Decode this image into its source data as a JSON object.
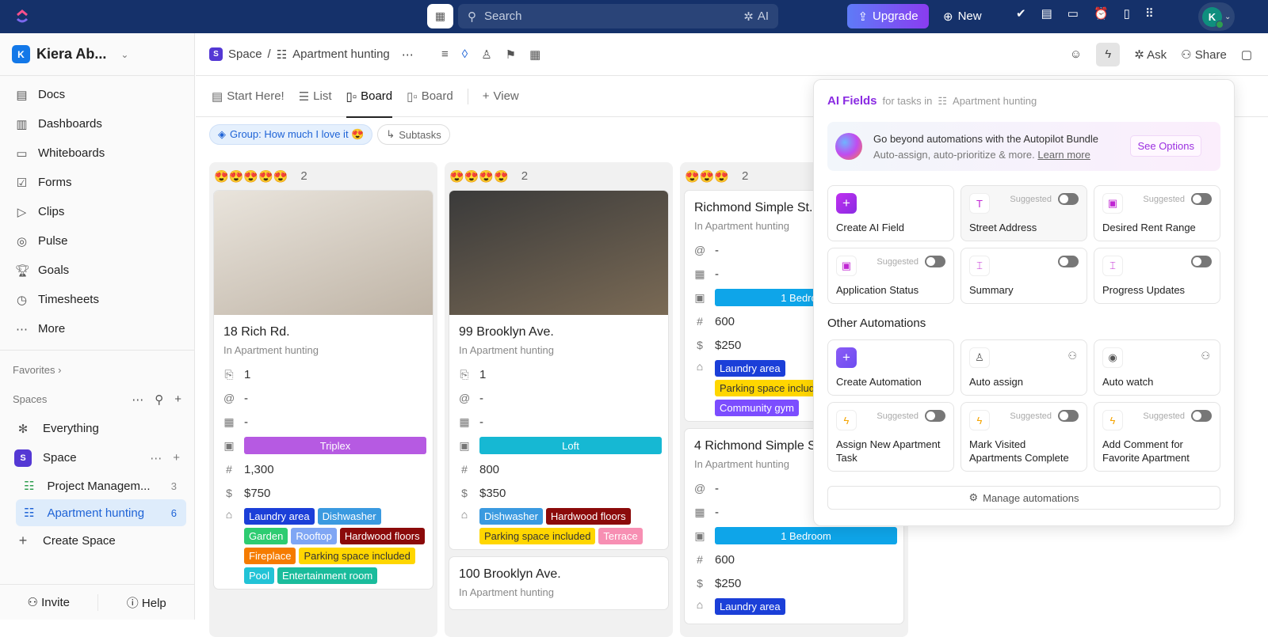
{
  "topbar": {
    "search_placeholder": "Search",
    "ai_label": "AI",
    "upgrade": "Upgrade",
    "new": "New",
    "avatar_initial": "K"
  },
  "sidebar": {
    "workspace": "Kiera Ab...",
    "workspace_initial": "K",
    "nav": [
      {
        "label": "Docs",
        "icon": "doc-icon"
      },
      {
        "label": "Dashboards",
        "icon": "dashboard-icon"
      },
      {
        "label": "Whiteboards",
        "icon": "whiteboard-icon"
      },
      {
        "label": "Forms",
        "icon": "form-icon"
      },
      {
        "label": "Clips",
        "icon": "clip-icon"
      },
      {
        "label": "Pulse",
        "icon": "pulse-icon"
      },
      {
        "label": "Goals",
        "icon": "trophy-icon"
      },
      {
        "label": "Timesheets",
        "icon": "timesheet-icon"
      },
      {
        "label": "More",
        "icon": "more-icon"
      }
    ],
    "favorites": "Favorites",
    "spaces": "Spaces",
    "everything": "Everything",
    "space": "Space",
    "space_initial": "S",
    "lists": [
      {
        "label": "Project Managem...",
        "count": "3"
      },
      {
        "label": "Apartment hunting",
        "count": "6",
        "active": true
      }
    ],
    "create_space": "Create Space",
    "invite": "Invite",
    "help": "Help"
  },
  "header": {
    "space": "Space",
    "space_initial": "S",
    "list": "Apartment hunting",
    "ask": "Ask",
    "share": "Share"
  },
  "tabs": [
    {
      "label": "Start Here!"
    },
    {
      "label": "List"
    },
    {
      "label": "Board",
      "active": true
    },
    {
      "label": "Board"
    },
    {
      "label": "View"
    }
  ],
  "chips": {
    "group": "Group: How much I love it 😍",
    "subtasks": "Subtasks"
  },
  "columns": [
    {
      "emoji": "😍😍😍😍😍",
      "count": "2",
      "cards": [
        {
          "image": true,
          "img_colors": [
            "#e9e4dc",
            "#bfb4a6"
          ],
          "title": "18 Rich Rd.",
          "sub": "In Apartment hunting",
          "attachments": "1",
          "assignee": "-",
          "date": "-",
          "type": {
            "label": "Triplex",
            "color": "#b65ae2"
          },
          "size": "1,300",
          "price": "$750",
          "tags": [
            {
              "label": "Laundry area",
              "color": "#1b3fd8"
            },
            {
              "label": "Dishwasher",
              "color": "#3a9ae0"
            },
            {
              "label": "Garden",
              "color": "#2ecc71"
            },
            {
              "label": "Rooftop",
              "color": "#7fa6f4"
            },
            {
              "label": "Hardwood floors",
              "color": "#8b0a0a"
            },
            {
              "label": "Fireplace",
              "color": "#f57c00"
            },
            {
              "label": "Parking space included",
              "color": "#ffd600",
              "dark": true
            },
            {
              "label": "Pool",
              "color": "#22c3d6"
            },
            {
              "label": "Entertainment room",
              "color": "#1abc9c"
            }
          ]
        }
      ]
    },
    {
      "emoji": "😍😍😍😍",
      "count": "2",
      "cards": [
        {
          "image": true,
          "img_colors": [
            "#3a3a3a",
            "#7a6a55"
          ],
          "title": "99 Brooklyn Ave.",
          "sub": "In Apartment hunting",
          "attachments": "1",
          "assignee": "-",
          "date": "-",
          "type": {
            "label": "Loft",
            "color": "#16b8d3"
          },
          "size": "800",
          "price": "$350",
          "tags": [
            {
              "label": "Dishwasher",
              "color": "#3a9ae0"
            },
            {
              "label": "Hardwood floors",
              "color": "#8b0a0a"
            },
            {
              "label": "Parking space included",
              "color": "#ffd600",
              "dark": true
            },
            {
              "label": "Terrace",
              "color": "#f78fb3"
            }
          ]
        },
        {
          "title": "100 Brooklyn Ave.",
          "sub": "In Apartment hunting"
        }
      ]
    },
    {
      "emoji": "😍😍😍",
      "count": "2",
      "cards": [
        {
          "title": "Richmond Simple St...",
          "sub": "In Apartment hunting",
          "assignee": "-",
          "date": "-",
          "type": {
            "label": "1 Bedroom",
            "color": "#0ea5e9"
          },
          "size": "600",
          "price": "$250",
          "tags": [
            {
              "label": "Laundry area",
              "color": "#1b3fd8"
            },
            {
              "label": "Parking space included",
              "color": "#ffd600",
              "dark": true
            },
            {
              "label": "Community gym",
              "color": "#7c4dff"
            }
          ]
        },
        {
          "title": "4 Richmond Simple St...",
          "sub": "In Apartment hunting",
          "assignee": "-",
          "date": "-",
          "type": {
            "label": "1 Bedroom",
            "color": "#0ea5e9"
          },
          "size": "600",
          "price": "$250",
          "tags": [
            {
              "label": "Laundry area",
              "color": "#1b3fd8"
            }
          ]
        }
      ]
    }
  ],
  "panel": {
    "title": "AI Fields",
    "subtitle": "for tasks in",
    "list": "Apartment hunting",
    "promo_title": "Go beyond automations with the Autopilot Bundle",
    "promo_sub": "Auto-assign, auto-prioritize & more.",
    "learn_more": "Learn more",
    "see_options": "See Options",
    "suggested": "Suggested",
    "ai_fields": [
      {
        "label": "Create AI Field",
        "icon": "plus-icon",
        "kind": "create"
      },
      {
        "label": "Street Address",
        "icon": "text-icon",
        "suggested": true,
        "toggle": false
      },
      {
        "label": "Desired Rent Range",
        "icon": "dropdown-field-icon",
        "suggested": true,
        "toggle": false
      },
      {
        "label": "Application Status",
        "icon": "dropdown-field-icon",
        "suggested": true,
        "toggle": false
      },
      {
        "label": "Summary",
        "icon": "ai-text-icon",
        "toggle": false
      },
      {
        "label": "Progress Updates",
        "icon": "ai-text-icon",
        "toggle": false
      }
    ],
    "other_title": "Other Automations",
    "automations": [
      {
        "label": "Create Automation",
        "icon": "plus-icon",
        "kind": "create"
      },
      {
        "label": "Auto assign",
        "icon": "user-icon",
        "action": "user-plus-icon"
      },
      {
        "label": "Auto watch",
        "icon": "eye-icon",
        "action": "user-plus-icon"
      },
      {
        "label": "Assign New Apartment Task",
        "icon": "bolt-icon",
        "suggested": true,
        "toggle": false
      },
      {
        "label": "Mark Visited Apartments Complete",
        "icon": "bolt-icon",
        "suggested": true,
        "toggle": false
      },
      {
        "label": "Add Comment for Favorite Apartment",
        "icon": "bolt-icon",
        "suggested": true,
        "toggle": false
      }
    ],
    "manage": "Manage automations"
  }
}
